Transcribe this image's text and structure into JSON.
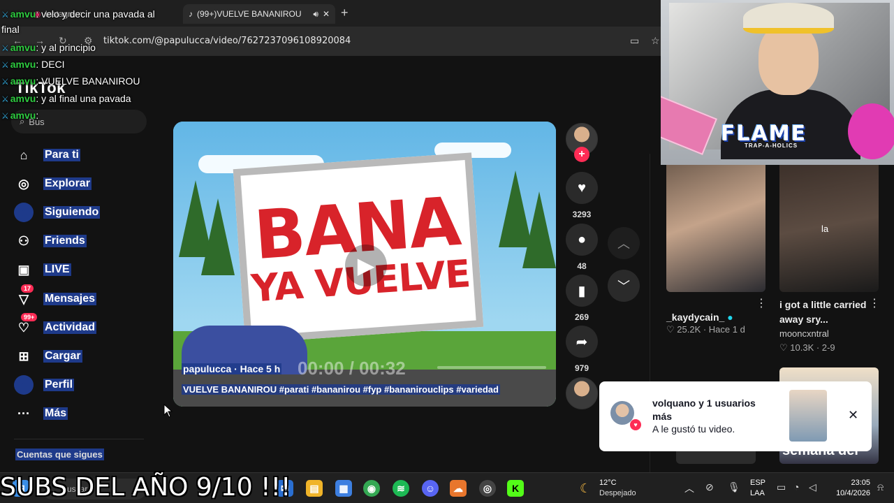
{
  "browser": {
    "tabs": [
      {
        "title": "Instagram"
      },
      {
        "title": "(99+)VUELVE BANANIROU"
      }
    ],
    "new_tab": "+",
    "url": "tiktok.com/@papulucca/video/7627237096108920084"
  },
  "sidebar": {
    "logo": "TikTok",
    "search_placeholder": "Bus",
    "items": [
      {
        "label": "Para ti",
        "icon": "home-icon",
        "glyph": "⌂"
      },
      {
        "label": "Explorar",
        "icon": "compass-icon",
        "glyph": "◎"
      },
      {
        "label": "Siguiendo",
        "icon": "following-icon",
        "glyph": "●"
      },
      {
        "label": "Friends",
        "icon": "friends-icon",
        "glyph": "⚇"
      },
      {
        "label": "LIVE",
        "icon": "live-icon",
        "glyph": "▣"
      },
      {
        "label": "Mensajes",
        "icon": "messages-icon",
        "glyph": "▽",
        "badge": "17"
      },
      {
        "label": "Actividad",
        "icon": "activity-icon",
        "glyph": "♡",
        "badge": "99+"
      },
      {
        "label": "Cargar",
        "icon": "upload-icon",
        "glyph": "⊞"
      },
      {
        "label": "Perfil",
        "icon": "profile-icon",
        "glyph": "●"
      },
      {
        "label": "Más",
        "icon": "more-icon",
        "glyph": "···"
      }
    ],
    "following_header": "Cuentas que sigues"
  },
  "video": {
    "billboard_line1": "BANA",
    "billboard_line2": "YA VUELVE",
    "author": "papulucca · Hace 5 h",
    "time": "00:00 / 00:32",
    "caption": "VUELVE BANANIROU #parati #bananirou #fyp #bananirouclips #variedad"
  },
  "actions": {
    "likes": "3293",
    "comments": "48",
    "saves": "269",
    "shares": "979"
  },
  "feed": [
    {
      "title": "",
      "author": "_kaydycain_",
      "meta": "♡ 25.2K · Hace 1 d"
    },
    {
      "title": "i got a little carried away sry...",
      "author": "mooncxntral",
      "meta": "♡ 10.3K · 2-9"
    },
    {
      "overlay_text": "semana del"
    }
  ],
  "notification": {
    "title": "volquano y 1 usuarios más",
    "subtitle": "A le gustó tu video."
  },
  "chat": [
    {
      "user": "amvu",
      "msg": "velo y decir una pavada al"
    },
    {
      "user": "",
      "msg": "final"
    },
    {
      "user": "amvu",
      "msg": "y al principio"
    },
    {
      "user": "amvu",
      "msg": "DECI"
    },
    {
      "user": "amvu",
      "msg": "VUELVE BANANIROU"
    },
    {
      "user": "amvu",
      "msg": "y al final una pavada"
    },
    {
      "user": "amvu",
      "msg": ""
    }
  ],
  "webcam": {
    "overlay_title": "FLAME",
    "overlay_sub": "TRAP-A-HOLICS"
  },
  "stream_caption": "SUBS DEL AÑO 9/10 !!!",
  "taskbar": {
    "search": "Buscar",
    "weather_temp": "12°C",
    "weather_desc": "Despejado",
    "lang1": "ESP",
    "lang2": "LAA",
    "time": "23:05",
    "date": "10/4/2026"
  },
  "colors": {
    "accent": "#fe2c55",
    "selection": "#1e3a8a",
    "chat_user": "#2ecc40"
  }
}
